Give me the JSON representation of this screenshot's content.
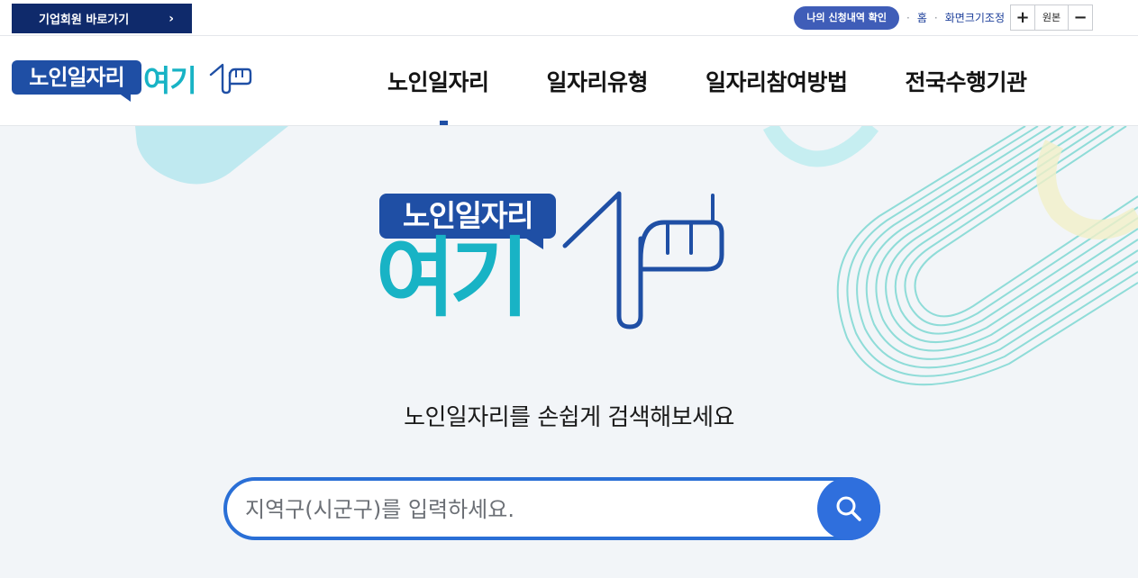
{
  "utility": {
    "corporate_link": "기업회원 바로가기",
    "corporate_chevron": "›",
    "my_application": "나의 신청내역 확인",
    "separator": "·",
    "home": "홈",
    "font_size_label": "화면크기조정",
    "zoom_in": "+",
    "zoom_reset": "원본",
    "zoom_out": "−"
  },
  "header": {
    "logo_top": "노인일자리",
    "logo_bottom": "여기",
    "nav": [
      {
        "label": "노인일자리",
        "active": true
      },
      {
        "label": "일자리유형"
      },
      {
        "label": "일자리참여방법"
      },
      {
        "label": "전국수행기관"
      }
    ]
  },
  "hero": {
    "logo_top": "노인일자리",
    "logo_bottom": "여기",
    "caption": "노인일자리를 손쉽게 검색해보세요",
    "search_placeholder": "지역구(시군구)를 입력하세요.",
    "search_icon": "search-icon"
  },
  "colors": {
    "navy": "#0f2a6b",
    "brand_blue": "#1f4fa5",
    "teal": "#18b3c5",
    "search_blue": "#2f6fdd",
    "background": "#f2f5f8"
  }
}
